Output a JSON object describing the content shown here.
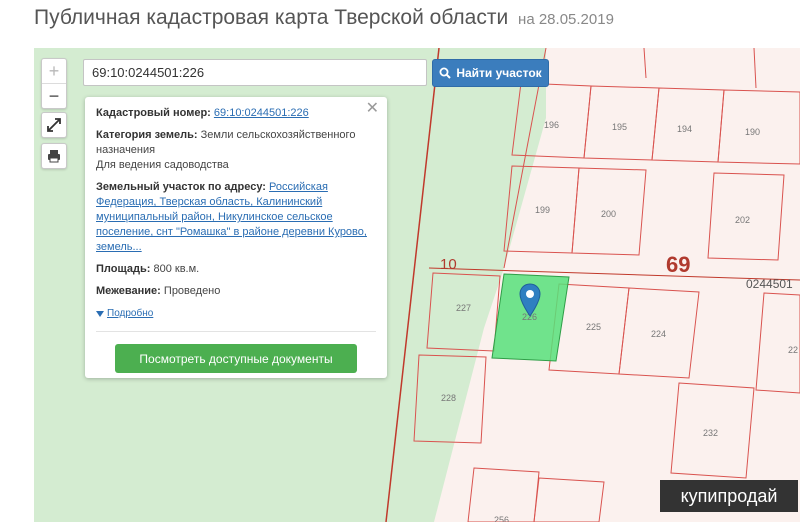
{
  "page": {
    "title": "Публичная кадастровая карта Тверской области",
    "date": "на 28.05.2019"
  },
  "controls": {
    "zoom_in": "+",
    "zoom_out": "−",
    "fullscreen_icon": "expand-icon",
    "print_icon": "print-icon"
  },
  "search": {
    "value": "69:10:0244501:226",
    "button_label": "Найти участок",
    "button_icon": "search-icon"
  },
  "info": {
    "cad_label": "Кадастровый номер:",
    "cad_value": "69:10:0244501:226",
    "cat_label": "Категория земель:",
    "cat_value": "Земли сельскохозяйственного назначения",
    "use_value": "Для ведения садоводства",
    "addr_label": "Земельный участок по адресу:",
    "addr_value": "Российская Федерация, Тверская область, Калининский муниципальный район, Никулинское сельское поселение, снт \"Ромашка\" в районе деревни Курово, земель...",
    "area_label": "Площадь:",
    "area_value": "800 кв.м.",
    "survey_label": "Межевание:",
    "survey_value": "Проведено",
    "more_label": "Подробно",
    "docs_button": "Посмотреть доступные документы"
  },
  "map_labels": {
    "region": "69",
    "district": "10",
    "quarter": "0244501",
    "parcels": [
      "196",
      "195",
      "194",
      "190",
      "199",
      "200",
      "202",
      "227",
      "226",
      "225",
      "224",
      "228",
      "232",
      "22",
      "256"
    ]
  },
  "colors": {
    "boundary": "#d9534f",
    "selected_fill": "#57e07a",
    "green_zone": "#d4ecd1",
    "accent_blue": "#3b7dbd",
    "button_green": "#4caf50"
  },
  "watermark": "купипродай"
}
